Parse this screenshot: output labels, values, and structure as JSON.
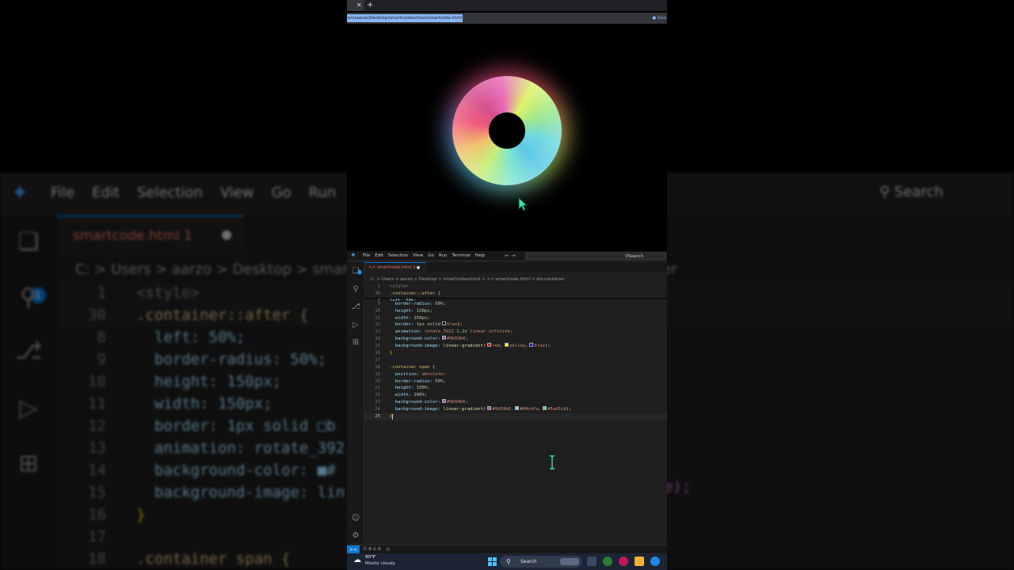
{
  "background_editor": {
    "menu": [
      "File",
      "Edit",
      "Selection",
      "View",
      "Go",
      "Run"
    ],
    "search": "Search",
    "badge": "1",
    "tab": "smartcode.html 1",
    "breadcrumb": "C: > Users > aarzo > Desktop > smartco",
    "lines": [
      {
        "n": "1",
        "text": "<style>"
      },
      {
        "n": "30",
        "text": ".container::after {"
      },
      {
        "n": "8",
        "text": "  left: 50%;"
      },
      {
        "n": "9",
        "text": "  border-radius: 50%;"
      },
      {
        "n": "10",
        "text": "  height: 150px;"
      },
      {
        "n": "11",
        "text": "  width: 150px;"
      },
      {
        "n": "12",
        "text": "  border: 1px solid □b"
      },
      {
        "n": "13",
        "text": "  animation: rotate_392"
      },
      {
        "n": "14",
        "text": "  background-color: ■#"
      },
      {
        "n": "15",
        "text": "  background-image: lin"
      },
      {
        "n": "16",
        "text": "}"
      },
      {
        "n": "17",
        "text": ""
      },
      {
        "n": "18",
        "text": ".container span {"
      }
    ],
    "right_fragments": [
      "er",
      "e);"
    ]
  },
  "browser": {
    "url": "ers/aarzo/Desktop/smartcodeschool/smartcode.html",
    "extension": "Geo"
  },
  "editor": {
    "menu": [
      "File",
      "Edit",
      "Selection",
      "View",
      "Go",
      "Run",
      "Terminal",
      "Help"
    ],
    "search": "Search",
    "badge": "1",
    "tab_label": "smartcode.html 1",
    "breadcrumb": "C: > Users > aarzo > Desktop > smartcodeschool > <> smartcode.html > div.container",
    "sticky_1": "<style>",
    "sticky_30": ".container::after {",
    "colors": {
      "purple": "#9b59b6",
      "blue_light": "#84cdfa",
      "teal": "#5ad1cd",
      "red": "#ff0000",
      "yellow": "#ffff00",
      "blue": "#0000ff",
      "black": "#000000"
    },
    "code": {
      "l8": "left: 50%;",
      "l9_prop": "border-radius:",
      "l9_val": "50%;",
      "l10_prop": "height:",
      "l10_val": "150px;",
      "l11_prop": "width:",
      "l11_val": "150px;",
      "l12_prop": "border:",
      "l12_val": "1px solid",
      "l12_color": "black;",
      "l13_prop": "animation:",
      "l13_name": "rotate_3922",
      "l13_dur": "1.2s",
      "l13_kw": "linear infinite;",
      "l14_prop": "background-color:",
      "l14_val": "#9b59b6;",
      "l15_prop": "background-image:",
      "l15_fn": "linear-gradient(",
      "l15_c1": "red,",
      "l15_c2": "yellow,",
      "l15_c3": "blue",
      "l15_end": ");",
      "l16": "}",
      "l18": ".container span {",
      "l19_prop": "position:",
      "l19_val": "absolute;",
      "l20_prop": "border-radius:",
      "l20_val": "50%;",
      "l21_prop": "height:",
      "l21_val": "100%;",
      "l22_prop": "width:",
      "l22_val": "100%;",
      "l23_prop": "background-color:",
      "l23_val": "#9b59b6;",
      "l24_prop": "background-image:",
      "l24_fn": "linear-gradient(",
      "l24_c1": "#9b59b6,",
      "l24_c2": "#84cdfa,",
      "l24_c3": "#5ad1cd",
      "l24_end": ");",
      "l25": "}"
    },
    "line_numbers": [
      "1",
      "30",
      "8",
      "9",
      "10",
      "11",
      "12",
      "13",
      "14",
      "15",
      "16",
      "17",
      "18",
      "19",
      "20",
      "21",
      "22",
      "23",
      "24",
      "25"
    ],
    "status_problems": "ⓧ 0 ⚠ 0",
    "status_remote": "><"
  },
  "taskbar": {
    "temp": "90°F",
    "condition": "Mostly cloudy",
    "search": "Search"
  }
}
